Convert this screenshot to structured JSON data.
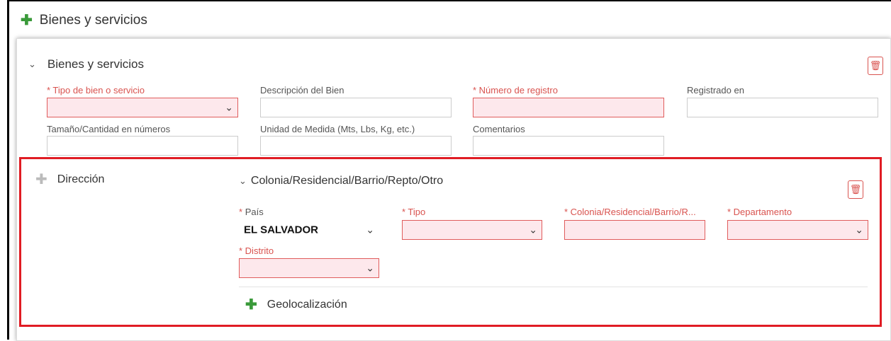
{
  "top_header": {
    "icon": "plus-icon",
    "title": "Bienes y servicios"
  },
  "section": {
    "title": "Bienes y servicios",
    "fields": {
      "tipo_bien": {
        "label": "* Tipo de bien o servicio",
        "value": ""
      },
      "descripcion": {
        "label": "Descripción del Bien",
        "value": ""
      },
      "numero_registro": {
        "label": "* Número de registro",
        "value": ""
      },
      "registrado_en": {
        "label": "Registrado en",
        "value": ""
      },
      "tamano": {
        "label": "Tamaño/Cantidad en números",
        "value": ""
      },
      "unidad": {
        "label": "Unidad de Medida (Mts, Lbs, Kg, etc.)",
        "value": ""
      },
      "comentarios": {
        "label": "Comentarios",
        "value": ""
      }
    }
  },
  "direccion": {
    "label": "Dirección",
    "subsection_title": "Colonia/Residencial/Barrio/Repto/Otro",
    "fields": {
      "pais": {
        "star": "*",
        "label": "País",
        "value": "EL SALVADOR"
      },
      "tipo": {
        "label": "* Tipo",
        "value": ""
      },
      "colonia": {
        "label": "* Colonia/Residencial/Barrio/R...",
        "value": ""
      },
      "departamento": {
        "label": "* Departamento",
        "value": ""
      },
      "distrito": {
        "label": "* Distrito",
        "value": ""
      }
    },
    "geolocalizacion": "Geolocalización"
  },
  "colors": {
    "error_border": "#e05c5c",
    "error_fill": "#fde8ec",
    "highlight": "#e01c24",
    "plus": "#3a9a3a"
  }
}
